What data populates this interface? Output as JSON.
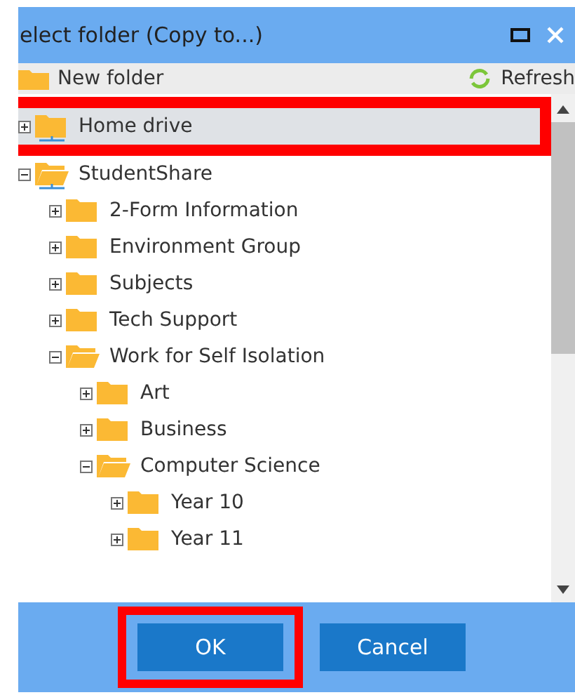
{
  "window": {
    "title": "elect folder (Copy to...)"
  },
  "toolbar": {
    "new_folder": "New folder",
    "refresh": "Refresh"
  },
  "tree": [
    {
      "label": "Home drive",
      "network": true,
      "expanded": false,
      "selected": true
    },
    {
      "label": "StudentShare",
      "network": true,
      "expanded": true,
      "selected": false,
      "children": [
        {
          "label": "2-Form Information",
          "expanded": false,
          "selected": false
        },
        {
          "label": "Environment Group",
          "expanded": false,
          "selected": false
        },
        {
          "label": "Subjects",
          "expanded": false,
          "selected": false
        },
        {
          "label": "Tech Support",
          "expanded": false,
          "selected": false
        },
        {
          "label": "Work for Self Isolation",
          "expanded": true,
          "selected": false,
          "children": [
            {
              "label": "Art",
              "expanded": false,
              "selected": false
            },
            {
              "label": "Business",
              "expanded": false,
              "selected": false
            },
            {
              "label": "Computer Science",
              "expanded": true,
              "selected": false,
              "children": [
                {
                  "label": "Year 10",
                  "expanded": false,
                  "selected": false
                },
                {
                  "label": "Year 11",
                  "expanded": false,
                  "selected": false
                }
              ]
            }
          ]
        }
      ]
    }
  ],
  "buttons": [
    {
      "label": "OK",
      "highlighted": true
    },
    {
      "label": "Cancel",
      "highlighted": false
    }
  ]
}
